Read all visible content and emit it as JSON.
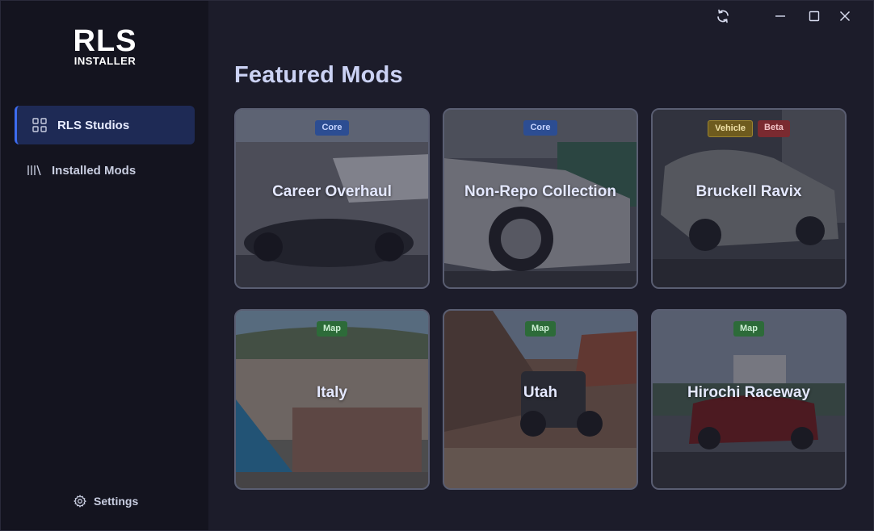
{
  "logo": {
    "main": "RLS",
    "sub": "INSTALLER"
  },
  "nav": {
    "items": [
      {
        "label": "RLS Studios",
        "icon": "grid-icon",
        "active": true
      },
      {
        "label": "Installed Mods",
        "icon": "library-icon",
        "active": false
      }
    ],
    "settings_label": "Settings"
  },
  "window": {
    "refresh_icon": "refresh-icon",
    "minimize_icon": "minimize-icon",
    "maximize_icon": "maximize-icon",
    "close_icon": "close-icon"
  },
  "page": {
    "title": "Featured Mods"
  },
  "mods": [
    {
      "title": "Career Overhaul",
      "tags": [
        "Core"
      ]
    },
    {
      "title": "Non-Repo Collection",
      "tags": [
        "Core"
      ]
    },
    {
      "title": "Bruckell Ravix",
      "tags": [
        "Vehicle",
        "Beta"
      ]
    },
    {
      "title": "Italy",
      "tags": [
        "Map"
      ]
    },
    {
      "title": "Utah",
      "tags": [
        "Map"
      ]
    },
    {
      "title": "Hirochi Raceway",
      "tags": [
        "Map"
      ]
    }
  ],
  "colors": {
    "accent": "#3d6cf0",
    "active_nav_bg": "#1e2a55",
    "sidebar_bg": "#14141f",
    "main_bg": "#1c1c2a"
  }
}
